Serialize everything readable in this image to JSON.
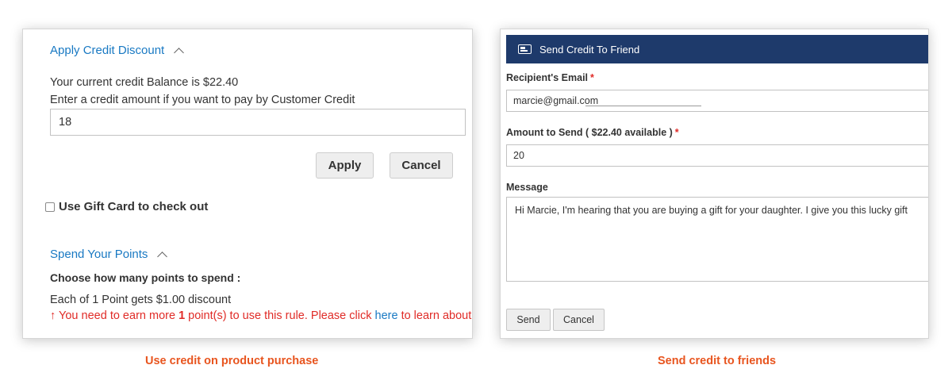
{
  "left_panel": {
    "credit_section": {
      "title": "Apply Credit Discount",
      "balance_text": "Your current credit Balance is $22.40",
      "instruction_text": "Enter a credit amount if you want to pay by Customer Credit",
      "amount_value": "18",
      "apply_label": "Apply",
      "cancel_label": "Cancel"
    },
    "gift_card": {
      "label": "Use Gift Card to check out",
      "checked": false
    },
    "points_section": {
      "title": "Spend Your Points",
      "heading": "Choose how many points to spend :",
      "rule_text": "Each of 1 Point gets $1.00 discount",
      "warning_arrow": "↑",
      "warning_prefix": "You need to earn more",
      "warning_count": "1",
      "warning_middle": "point(s) to use this rule. Please click",
      "warning_link": "here",
      "warning_suffix": "to learn about it."
    }
  },
  "right_panel": {
    "header_title": "Send Credit To Friend",
    "header_icon": "credit-card-icon",
    "header_color": "#1e3a6b",
    "email_label": "Recipient's Email",
    "email_value": "marcie@gmail.com",
    "amount_label": "Amount to Send ( $22.40 available )",
    "amount_value": "20",
    "message_label": "Message",
    "message_value": "Hi Marcie, I'm hearing that you are buying a gift for your daughter. I give you this lucky gift",
    "required_marker": "*",
    "send_label": "Send",
    "cancel_label": "Cancel"
  },
  "captions": {
    "left": "Use credit on product purchase",
    "right": "Send credit to friends"
  },
  "colors": {
    "link": "#1979c3",
    "error": "#e02b27",
    "caption": "#e8551f"
  }
}
